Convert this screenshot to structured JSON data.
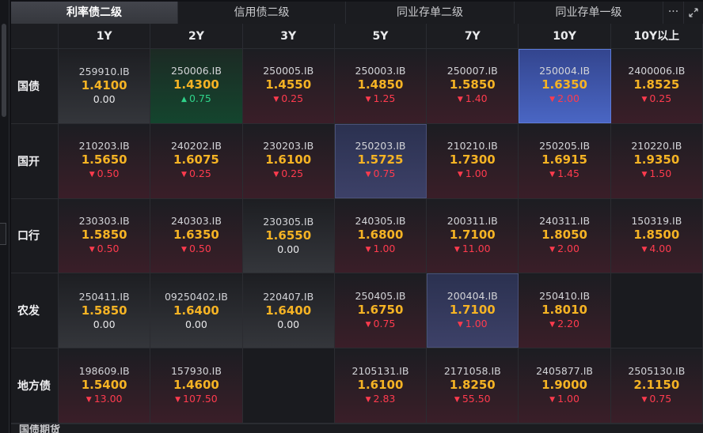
{
  "tabs": [
    {
      "label": "利率债二级",
      "active": true
    },
    {
      "label": "信用债二级",
      "active": false
    },
    {
      "label": "同业存单二级",
      "active": false
    },
    {
      "label": "同业存单一级",
      "active": false
    }
  ],
  "toolbar": {
    "more_icon": "more-horizontal-icon",
    "expand_icon": "expand-icon"
  },
  "columns": [
    "1Y",
    "2Y",
    "3Y",
    "5Y",
    "7Y",
    "10Y",
    "10Y以上"
  ],
  "colors": {
    "yield": "#f5b324",
    "down": "#ff3b4e",
    "up": "#2fd38a",
    "highlight": "#4a66c4"
  },
  "rows": [
    {
      "label": "国债",
      "cells": [
        {
          "code": "259910.IB",
          "yield": "1.4100",
          "change": "0.00",
          "dir": "flat"
        },
        {
          "code": "250006.IB",
          "yield": "1.4300",
          "change": "0.75",
          "dir": "up"
        },
        {
          "code": "250005.IB",
          "yield": "1.4550",
          "change": "0.25",
          "dir": "down"
        },
        {
          "code": "250003.IB",
          "yield": "1.4850",
          "change": "1.25",
          "dir": "down"
        },
        {
          "code": "250007.IB",
          "yield": "1.5850",
          "change": "1.40",
          "dir": "down"
        },
        {
          "code": "250004.IB",
          "yield": "1.6350",
          "change": "2.00",
          "dir": "down",
          "hl": "blue"
        },
        {
          "code": "2400006.IB",
          "yield": "1.8525",
          "change": "0.25",
          "dir": "down"
        }
      ]
    },
    {
      "label": "国开",
      "cells": [
        {
          "code": "210203.IB",
          "yield": "1.5650",
          "change": "0.50",
          "dir": "down"
        },
        {
          "code": "240202.IB",
          "yield": "1.6075",
          "change": "0.25",
          "dir": "down"
        },
        {
          "code": "230203.IB",
          "yield": "1.6100",
          "change": "0.25",
          "dir": "down"
        },
        {
          "code": "250203.IB",
          "yield": "1.5725",
          "change": "0.75",
          "dir": "down",
          "hl": "soft"
        },
        {
          "code": "210210.IB",
          "yield": "1.7300",
          "change": "1.00",
          "dir": "down"
        },
        {
          "code": "250205.IB",
          "yield": "1.6915",
          "change": "1.45",
          "dir": "down"
        },
        {
          "code": "210220.IB",
          "yield": "1.9350",
          "change": "1.50",
          "dir": "down"
        }
      ]
    },
    {
      "label": "口行",
      "cells": [
        {
          "code": "230303.IB",
          "yield": "1.5850",
          "change": "0.50",
          "dir": "down"
        },
        {
          "code": "240303.IB",
          "yield": "1.6350",
          "change": "0.50",
          "dir": "down"
        },
        {
          "code": "230305.IB",
          "yield": "1.6550",
          "change": "0.00",
          "dir": "flat"
        },
        {
          "code": "240305.IB",
          "yield": "1.6800",
          "change": "1.00",
          "dir": "down"
        },
        {
          "code": "200311.IB",
          "yield": "1.7100",
          "change": "11.00",
          "dir": "down"
        },
        {
          "code": "240311.IB",
          "yield": "1.8050",
          "change": "2.00",
          "dir": "down"
        },
        {
          "code": "150319.IB",
          "yield": "1.8500",
          "change": "4.00",
          "dir": "down"
        }
      ]
    },
    {
      "label": "农发",
      "cells": [
        {
          "code": "250411.IB",
          "yield": "1.5850",
          "change": "0.00",
          "dir": "flat"
        },
        {
          "code": "09250402.IB",
          "yield": "1.6400",
          "change": "0.00",
          "dir": "flat"
        },
        {
          "code": "220407.IB",
          "yield": "1.6400",
          "change": "0.00",
          "dir": "flat"
        },
        {
          "code": "250405.IB",
          "yield": "1.6750",
          "change": "0.75",
          "dir": "down"
        },
        {
          "code": "200404.IB",
          "yield": "1.7100",
          "change": "1.00",
          "dir": "down",
          "hl": "soft"
        },
        {
          "code": "250410.IB",
          "yield": "1.8010",
          "change": "2.20",
          "dir": "down"
        },
        null
      ]
    },
    {
      "label": "地方债",
      "cells": [
        {
          "code": "198609.IB",
          "yield": "1.5400",
          "change": "13.00",
          "dir": "down"
        },
        {
          "code": "157930.IB",
          "yield": "1.4600",
          "change": "107.50",
          "dir": "down"
        },
        null,
        {
          "code": "2105131.IB",
          "yield": "1.6100",
          "change": "2.83",
          "dir": "down"
        },
        {
          "code": "2171058.IB",
          "yield": "1.8250",
          "change": "55.50",
          "dir": "down"
        },
        {
          "code": "2405877.IB",
          "yield": "1.9000",
          "change": "1.00",
          "dir": "down"
        },
        {
          "code": "2505130.IB",
          "yield": "2.1150",
          "change": "0.75",
          "dir": "down"
        }
      ]
    }
  ],
  "bottom": {
    "label": "国债期货"
  }
}
